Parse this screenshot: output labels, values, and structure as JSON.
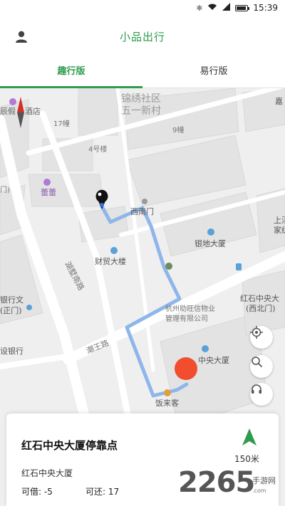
{
  "status": {
    "time": "15:39"
  },
  "header": {
    "title": "小品出行"
  },
  "tabs": [
    {
      "label": "趣行版",
      "active": true
    },
    {
      "label": "易行版",
      "active": false
    }
  ],
  "map": {
    "labels": {
      "community": "锦绣社区",
      "village": "五一新村",
      "hotel": "辰假",
      "hotel2": "酒店",
      "bldg17": "17幢",
      "bldg9": "9幢",
      "bldg4": "4号楼",
      "leilei": "蕾蕾",
      "xinanmen": "西南门",
      "yindi": "银地大厦",
      "caimao": "财贸大楼",
      "road_hu": "湖墅南路",
      "road_chao": "潮王路",
      "hongshi": "红石中央大",
      "hongshi_gate": "(西北门)",
      "wuye1": "杭州助旺信物业",
      "wuye2": "管理有限公司",
      "zhongyang": "中央大厦",
      "fanlaike": "饭来客",
      "bank1": "银行文",
      "bank1b": "(正门)",
      "bank2": "设银行",
      "jia": "嘉",
      "shang": "上汤",
      "jiayuan": "家纺",
      "left_mark": "门)"
    },
    "colors": {
      "route": "#8fb6ea",
      "marker": "#f04e2e",
      "accent": "#2e9b4e"
    }
  },
  "controls": [
    {
      "icon": "locate-icon"
    },
    {
      "icon": "search-icon"
    },
    {
      "icon": "headset-icon"
    }
  ],
  "card": {
    "name": "红石中央大厦停靠点",
    "subtitle": "红石中央大厦",
    "borrow": "可借: -5",
    "return": "可还: 17",
    "distance": "150米"
  },
  "watermark": {
    "number": "2265",
    "site": "手游网",
    "domain": ".com"
  }
}
